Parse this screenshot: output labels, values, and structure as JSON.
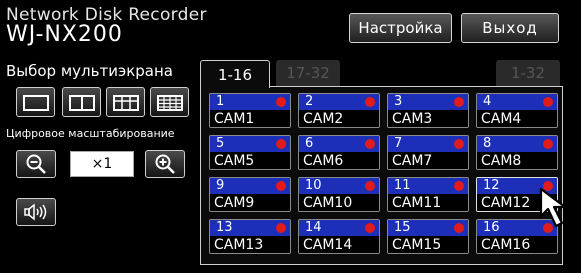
{
  "app": {
    "title": "Network Disk Recorder",
    "model": "WJ-NX200"
  },
  "header": {
    "settings_label": "Настройка",
    "exit_label": "Выход"
  },
  "multiscreen": {
    "label": "Выбор мультиэкрана",
    "layouts": [
      "1-screen-layout-icon",
      "4-screen-layout-icon",
      "9-screen-layout-icon",
      "16-screen-layout-icon"
    ]
  },
  "zoom": {
    "label": "Цифровое масштабирование",
    "value": "×1",
    "zoom_out_icon": "zoom-out-icon",
    "zoom_in_icon": "zoom-in-icon"
  },
  "audio": {
    "icon": "speaker-icon"
  },
  "tabs": [
    {
      "label": "1-16",
      "active": true
    },
    {
      "label": "17-32",
      "active": false
    },
    {
      "label": "1-32",
      "active": false
    }
  ],
  "cameras": [
    {
      "num": "1",
      "name": "CAM1"
    },
    {
      "num": "2",
      "name": "CAM2"
    },
    {
      "num": "3",
      "name": "CAM3"
    },
    {
      "num": "4",
      "name": "CAM4"
    },
    {
      "num": "5",
      "name": "CAM5"
    },
    {
      "num": "6",
      "name": "CAM6"
    },
    {
      "num": "7",
      "name": "CAM7"
    },
    {
      "num": "8",
      "name": "CAM8"
    },
    {
      "num": "9",
      "name": "CAM9"
    },
    {
      "num": "10",
      "name": "CAM10"
    },
    {
      "num": "11",
      "name": "CAM11"
    },
    {
      "num": "12",
      "name": "CAM12"
    },
    {
      "num": "13",
      "name": "CAM13"
    },
    {
      "num": "14",
      "name": "CAM14"
    },
    {
      "num": "15",
      "name": "CAM15"
    },
    {
      "num": "16",
      "name": "CAM16"
    }
  ],
  "colors": {
    "tile_header": "#1d2fb8",
    "recording_dot": "#e11a1a",
    "background": "#000000"
  }
}
